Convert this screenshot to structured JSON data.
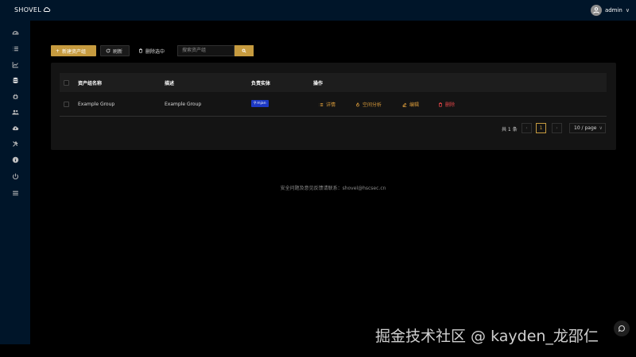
{
  "header": {
    "logo_text": "SHOVEL",
    "username": "admin"
  },
  "sidebar": {
    "icons": [
      "dashboard-icon",
      "list-icon",
      "chart-icon",
      "database-icon",
      "bug-icon",
      "team-icon",
      "cloud-upload-icon",
      "tool-icon",
      "info-icon",
      "power-icon",
      "menu-icon"
    ]
  },
  "toolbar": {
    "add_label": "新建资产组",
    "refresh_label": "刷新",
    "delete_label": "删除选中",
    "search_placeholder": "搜索资产组"
  },
  "table": {
    "columns": [
      "资产组名称",
      "描述",
      "负责实体",
      "操作"
    ],
    "rows": [
      {
        "name": "Example Group",
        "description": "Example Group",
        "owner": "mjan"
      }
    ],
    "actions": [
      "详情",
      "空间分析",
      "编辑",
      "删除"
    ]
  },
  "pagination": {
    "total_text": "共 1 条",
    "current_page": "1",
    "page_size": "10 / page"
  },
  "footer": {
    "text": "安全问题及意见反馈请联系：shovel@hscsec.cn"
  },
  "watermark": "掘金技术社区 @ kayden_龙邵仁",
  "colors": {
    "accent": "#c69b3f",
    "nav_bg": "#001529",
    "danger": "#e84749",
    "tag_bg": "#1d39c4"
  }
}
